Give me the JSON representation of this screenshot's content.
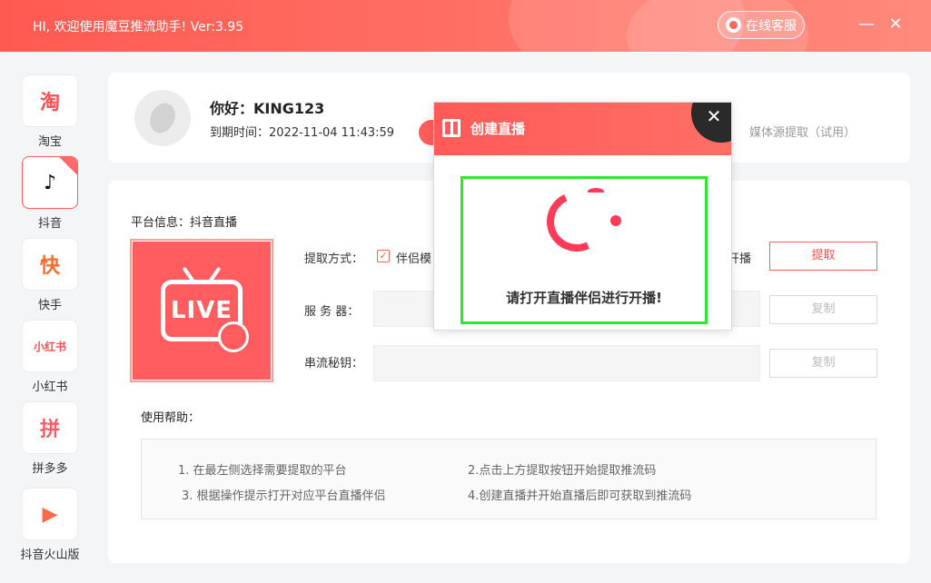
{
  "app": {
    "title": "HI, 欢迎使用魔豆推流助手! Ver:3.95",
    "service_label": "在线客服",
    "minimize": "—",
    "close": "✕"
  },
  "sidebar": {
    "items": [
      {
        "label": "淘宝",
        "glyph": "淘"
      },
      {
        "label": "抖音",
        "glyph": "♪",
        "active": true
      },
      {
        "label": "快手",
        "glyph": "快"
      },
      {
        "label": "小红书",
        "glyph": "小红书"
      },
      {
        "label": "拼多多",
        "glyph": "拼"
      },
      {
        "label": "抖音火山版",
        "glyph": "▶"
      }
    ]
  },
  "user": {
    "greeting": "你好：KING123",
    "expire": "到期时间：2022-11-04 11:43:59",
    "media_link": "媒体源提取（试用）"
  },
  "platform": {
    "info": "平台信息：抖音直播",
    "logo_text": "LIVE"
  },
  "form": {
    "method_label": "提取方式：",
    "method_option": "伴侣模",
    "method_option_tail": "开播",
    "check_mark": "✓",
    "server_label": "服 务 器：",
    "key_label": "串流秘钥：",
    "extract_button": "提取",
    "copy_button": "复制"
  },
  "help": {
    "title": "使用帮助：",
    "items": [
      "1. 在最左侧选择需要提取的平台",
      "2.点击上方提取按钮开始提取推流码",
      "3. 根据操作提示打开对应平台直播伴侣",
      "4.创建直播并开始直播后即可获取到推流码"
    ]
  },
  "modal": {
    "title": "创建直播",
    "close": "✕",
    "message": "请打开直播伴侣进行开播!"
  },
  "colors": {
    "accent": "#ff5a52",
    "highlight": "#2ee62e"
  }
}
